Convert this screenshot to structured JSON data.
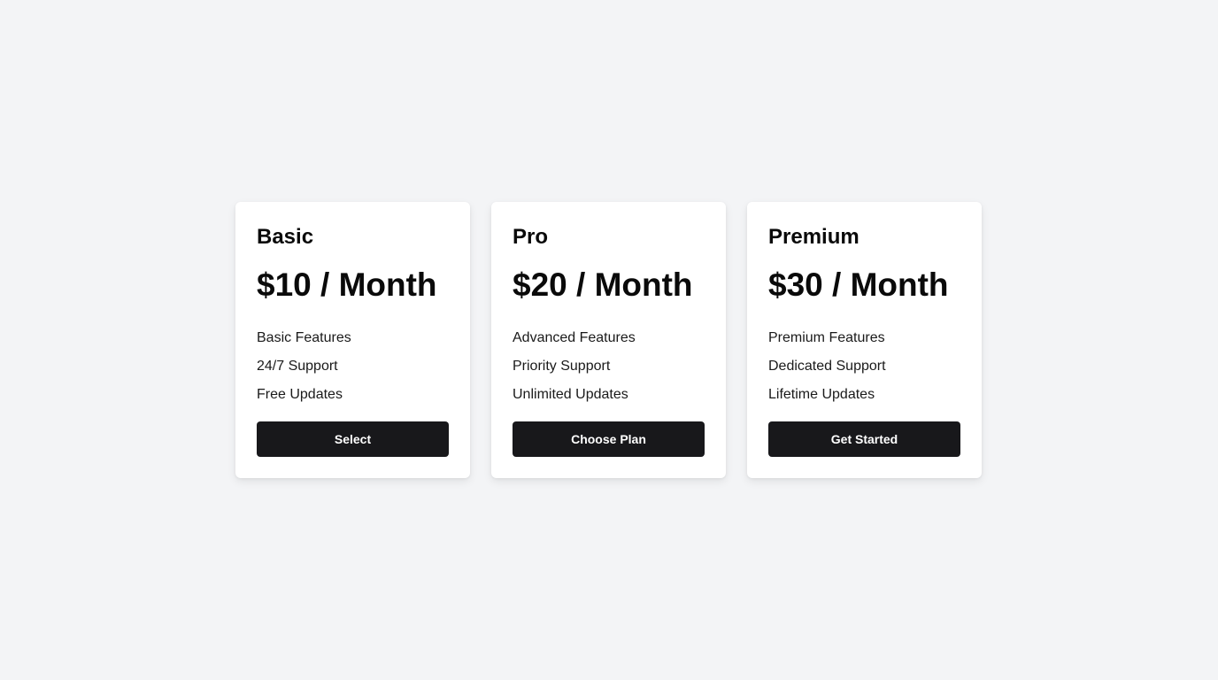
{
  "plans": [
    {
      "name": "Basic",
      "price": "$10 / Month",
      "features": [
        "Basic Features",
        "24/7 Support",
        "Free Updates"
      ],
      "button_label": "Select"
    },
    {
      "name": "Pro",
      "price": "$20 / Month",
      "features": [
        "Advanced Features",
        "Priority Support",
        "Unlimited Updates"
      ],
      "button_label": "Choose Plan"
    },
    {
      "name": "Premium",
      "price": "$30 / Month",
      "features": [
        "Premium Features",
        "Dedicated Support",
        "Lifetime Updates"
      ],
      "button_label": "Get Started"
    }
  ],
  "colors": {
    "background": "#f3f4f6",
    "card": "#ffffff",
    "button": "#18181b",
    "button_text": "#ffffff"
  }
}
